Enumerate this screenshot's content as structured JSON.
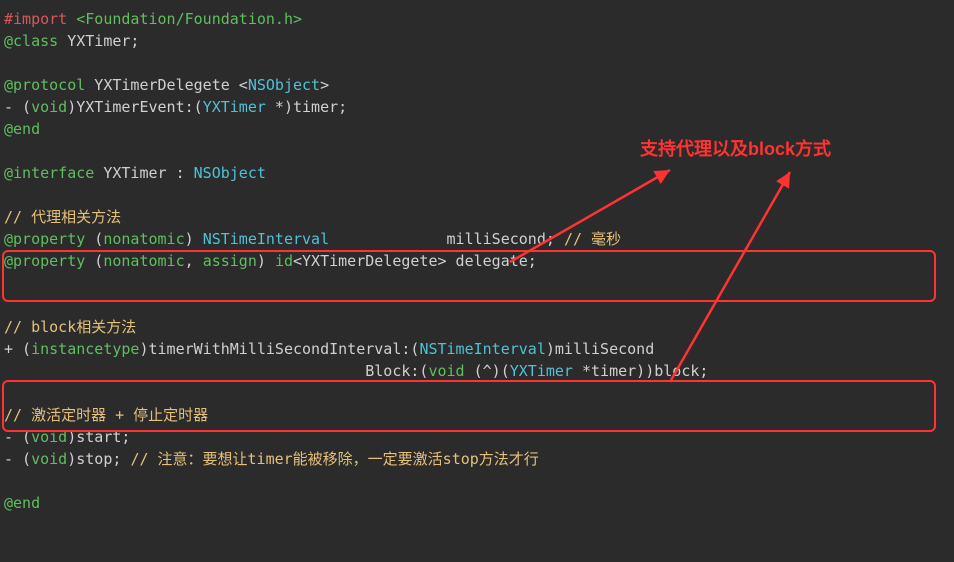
{
  "annotation": "支持代理以及block方式",
  "tokens": {
    "l1a": "#import ",
    "l1b": "<Foundation/Foundation.h>",
    "l2a": "@class",
    "l2b": " YXTimer;",
    "l4a": "@protocol",
    "l4b": " YXTimerDelegete <",
    "l4c": "NSObject",
    "l4d": ">",
    "l5a": "- (",
    "l5b": "void",
    "l5c": ")YXTimerEvent:(",
    "l5d": "YXTimer",
    "l5e": " *)timer;",
    "l6a": "@end",
    "l8a": "@interface",
    "l8b": " YXTimer : ",
    "l8c": "NSObject",
    "l10": "// 代理相关方法",
    "l11a": "@property",
    "l11b": " (",
    "l11c": "nonatomic",
    "l11d": ") ",
    "l11e": "NSTimeInterval",
    "l11f": "             milliSecond; ",
    "l11g": "// 毫秒",
    "l12a": "@property",
    "l12b": " (",
    "l12c": "nonatomic",
    "l12d": ", ",
    "l12e": "assign",
    "l12f": ") ",
    "l12g": "id",
    "l12h": "<YXTimerDelegete> delegate;",
    "l15": "// block相关方法",
    "l16a": "+ (",
    "l16b": "instancetype",
    "l16c": ")timerWithMilliSecondInterval:(",
    "l16d": "NSTimeInterval",
    "l16e": ")milliSecond",
    "l17a": "                                        Block:(",
    "l17b": "void",
    "l17c": " (^)(",
    "l17d": "YXTimer",
    "l17e": " *timer))block;",
    "l19": "// 激活定时器 + 停止定时器",
    "l20a": "- (",
    "l20b": "void",
    "l20c": ")start;",
    "l21a": "- (",
    "l21b": "void",
    "l21c": ")stop; ",
    "l21d": "// 注意：要想让timer能被移除，一定要激活stop方法才行",
    "l23a": "@end"
  }
}
